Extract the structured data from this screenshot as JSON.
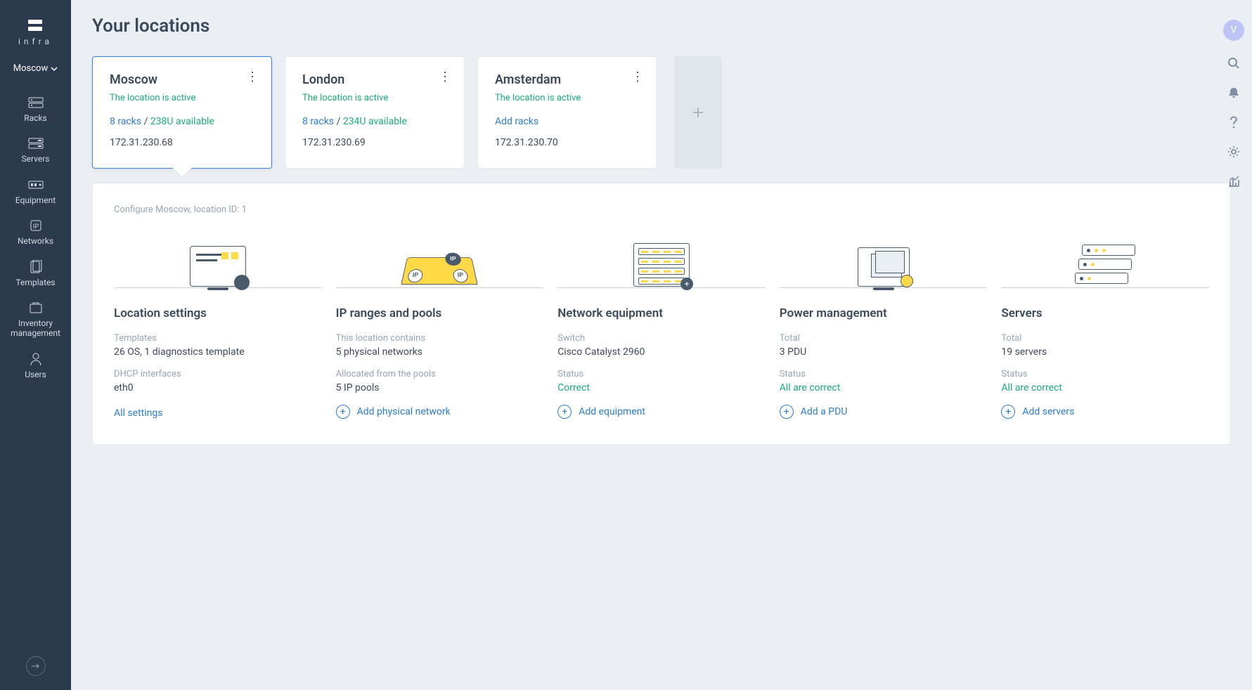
{
  "brand": "infra",
  "location_selector": "Moscow",
  "page_title": "Your locations",
  "avatar_initial": "V",
  "sidebar_items": [
    {
      "label": "Racks"
    },
    {
      "label": "Servers"
    },
    {
      "label": "Equipment"
    },
    {
      "label": "Networks"
    },
    {
      "label": "Templates"
    },
    {
      "label": "Inventory management"
    },
    {
      "label": "Users"
    }
  ],
  "locations": [
    {
      "name": "Moscow",
      "status": "The location is active",
      "racks": "8 racks",
      "available": "238U available",
      "ip": "172.31.230.68",
      "add_racks": false
    },
    {
      "name": "London",
      "status": "The location is active",
      "racks": "8 racks",
      "available": "234U available",
      "ip": "172.31.230.69",
      "add_racks": false
    },
    {
      "name": "Amsterdam",
      "status": "The location is active",
      "racks": "",
      "available": "",
      "ip": "172.31.230.70",
      "add_racks": true,
      "add_racks_label": "Add racks"
    }
  ],
  "detail": {
    "header": "Configure Moscow, location ID: 1",
    "sections": [
      {
        "title": "Location settings",
        "m1_label": "Templates",
        "m1_value": "26 OS, 1 diagnostics template",
        "m2_label": "DHCP interfaces",
        "m2_value": "eth0",
        "m2_ok": false,
        "action": "All settings",
        "action_icon": false
      },
      {
        "title": "IP ranges and pools",
        "m1_label": "This location contains",
        "m1_value": "5 physical networks",
        "m2_label": "Allocated from the pools",
        "m2_value": "5 IP pools",
        "m2_ok": false,
        "action": "Add physical network",
        "action_icon": true
      },
      {
        "title": "Network equipment",
        "m1_label": "Switch",
        "m1_value": "Cisco Catalyst 2960",
        "m2_label": "Status",
        "m2_value": "Correct",
        "m2_ok": true,
        "action": "Add equipment",
        "action_icon": true
      },
      {
        "title": "Power management",
        "m1_label": "Total",
        "m1_value": "3 PDU",
        "m2_label": "Status",
        "m2_value": "All are correct",
        "m2_ok": true,
        "action": "Add a PDU",
        "action_icon": true
      },
      {
        "title": "Servers",
        "m1_label": "Total",
        "m1_value": "19 servers",
        "m2_label": "Status",
        "m2_value": "All are correct",
        "m2_ok": true,
        "action": "Add servers",
        "action_icon": true
      }
    ]
  }
}
